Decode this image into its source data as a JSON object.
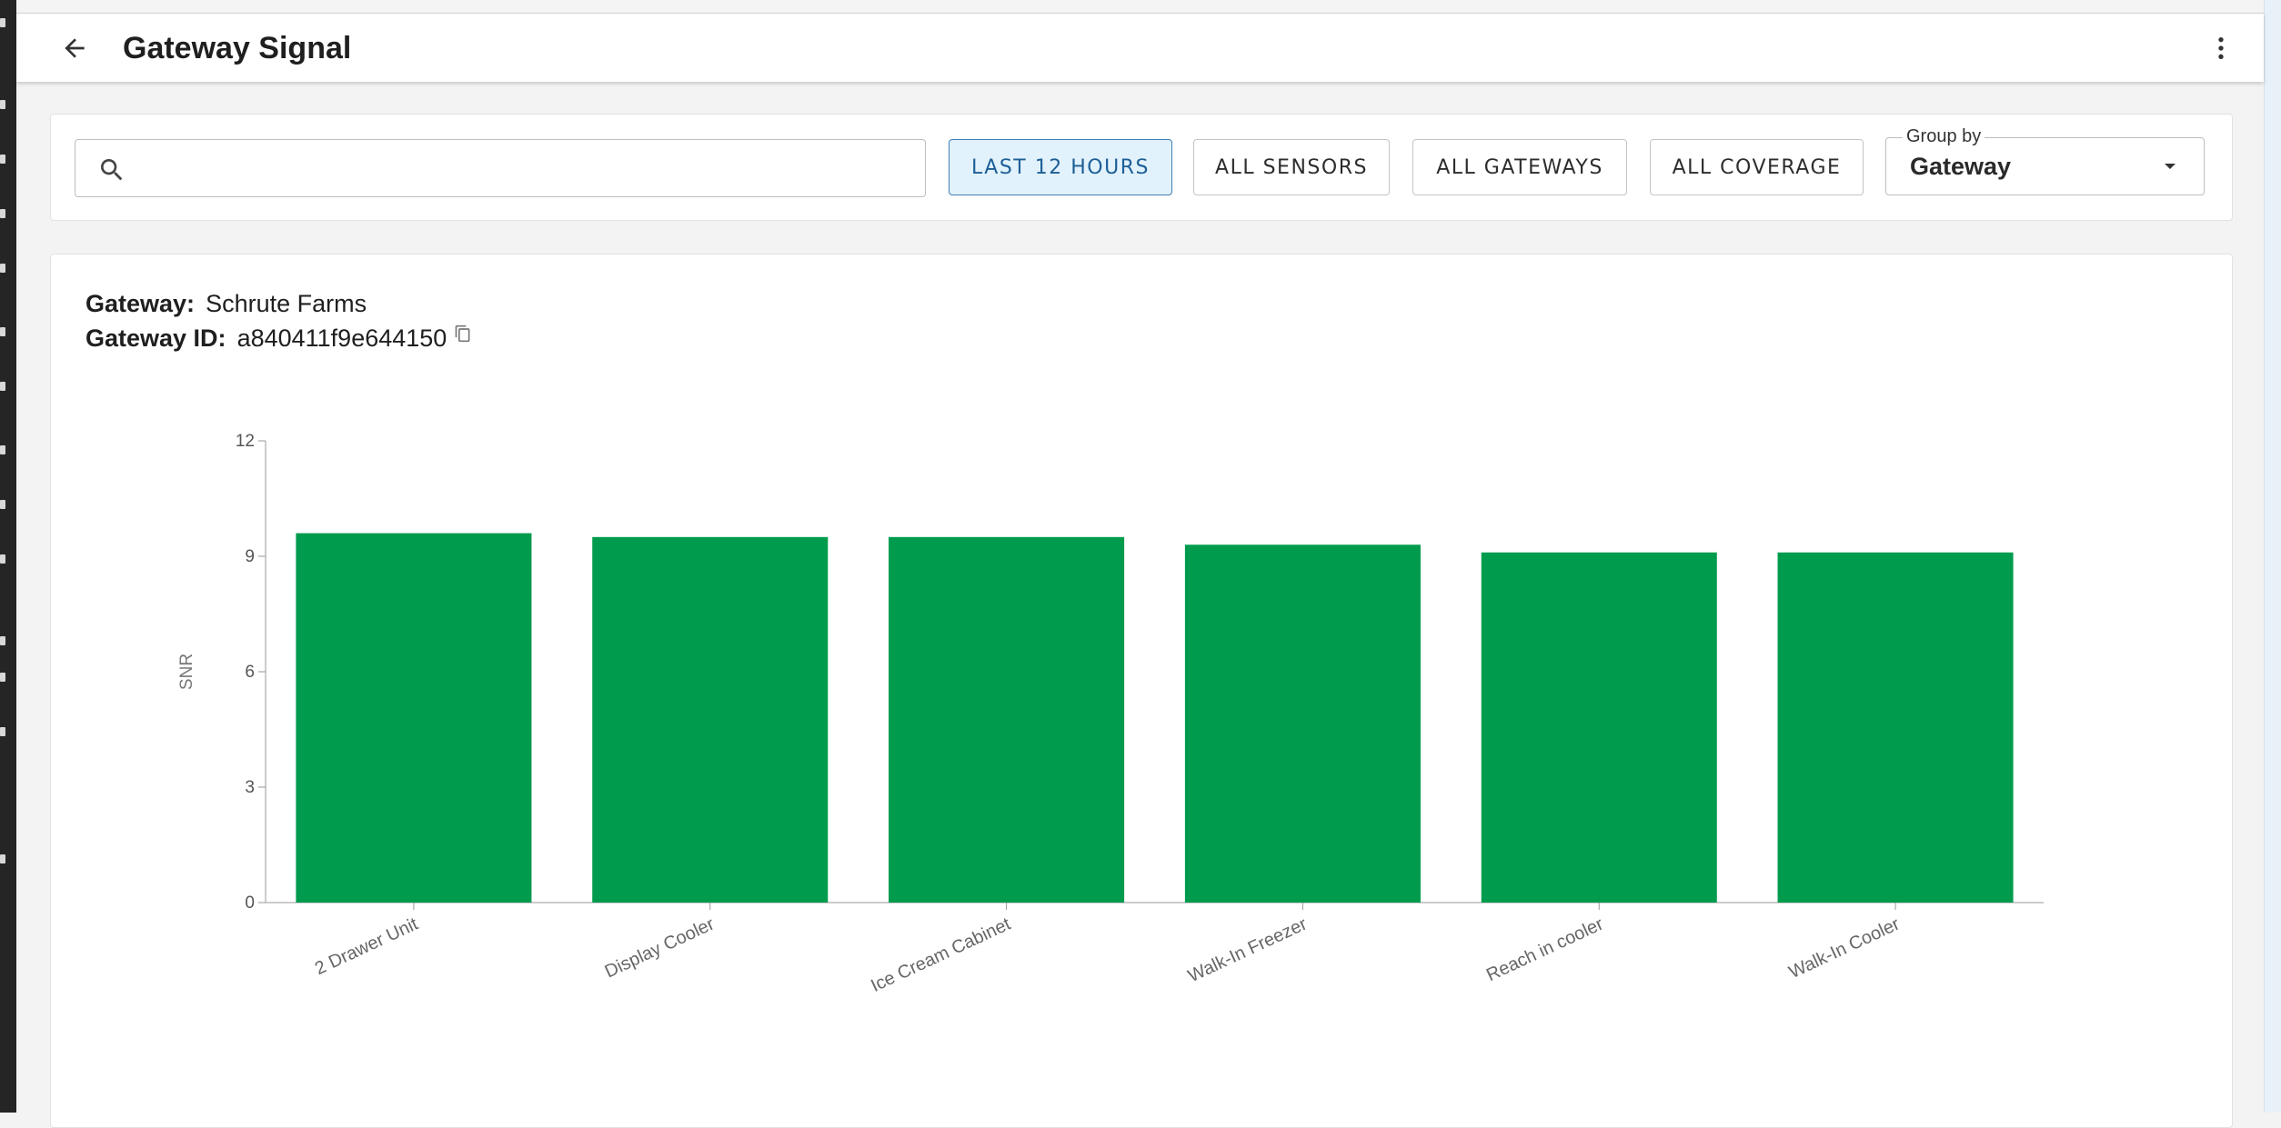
{
  "header": {
    "title": "Gateway Signal"
  },
  "filters": {
    "search_placeholder": "",
    "time_range": "LAST 12 HOURS",
    "sensors": "ALL SENSORS",
    "gateways": "ALL GATEWAYS",
    "coverage": "ALL COVERAGE",
    "group_by_label": "Group by",
    "group_by_value": "Gateway"
  },
  "gateway": {
    "name_label": "Gateway:",
    "name": "Schrute Farms",
    "id_label": "Gateway ID:",
    "id": "a840411f9e644150"
  },
  "colors": {
    "bar": "#009b4d",
    "active_filter_bg": "#e2f2fc"
  },
  "chart_data": {
    "type": "bar",
    "categories": [
      "2 Drawer Unit",
      "Display Cooler",
      "Ice Cream Cabinet",
      "Walk-In Freezer",
      "Reach in cooler",
      "Walk-In Cooler"
    ],
    "values": [
      9.6,
      9.5,
      9.5,
      9.3,
      9.1,
      9.1
    ],
    "ylabel": "SNR",
    "ylim": [
      0,
      12
    ],
    "yticks": [
      0,
      3,
      6,
      9,
      12
    ],
    "grid": false,
    "legend": "none"
  }
}
